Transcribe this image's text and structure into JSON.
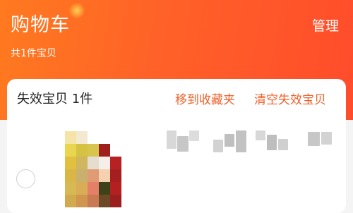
{
  "header": {
    "title": "购物车",
    "manage_label": "管理",
    "count_text": "共1件宝贝"
  },
  "invalid_section": {
    "title": "失效宝贝 1件",
    "move_to_favorites_label": "移到收藏夹",
    "clear_invalid_label": "清空失效宝贝"
  },
  "colors": {
    "header_gradient_start": "#ff7a1f",
    "header_gradient_end": "#ff4c2b",
    "action_text": "#f0612a",
    "card_background": "#ffffff",
    "title_text": "#222222"
  },
  "icons": {
    "glow": "decorative-glow-icon",
    "radio": "unchecked-radio-icon"
  }
}
